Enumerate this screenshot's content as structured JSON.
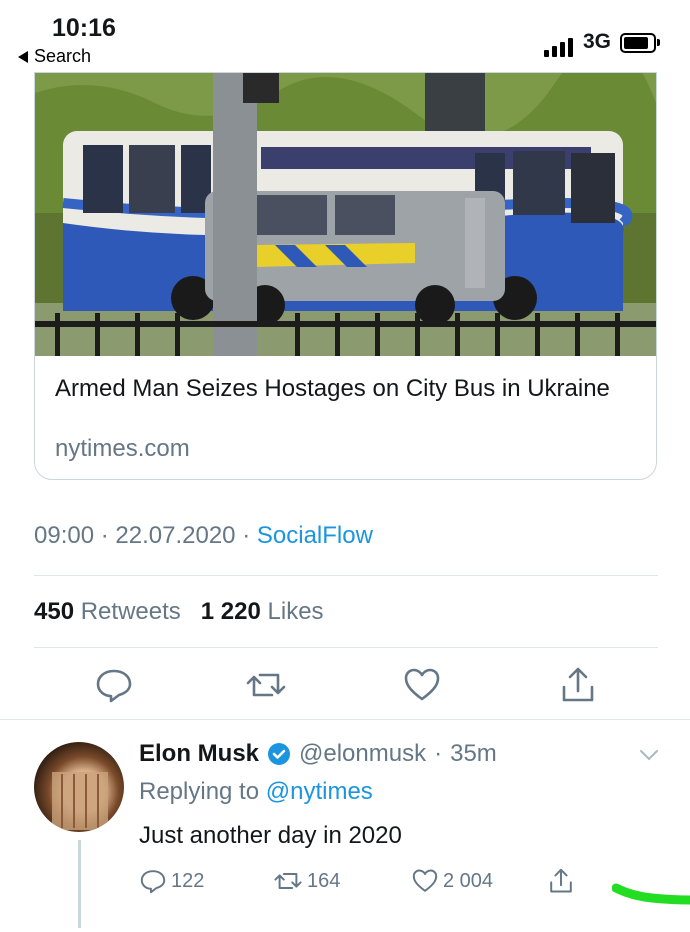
{
  "status": {
    "time": "10:16",
    "back_label": "Search",
    "network": "3G",
    "battery_level": 0.85
  },
  "card": {
    "title": "Armed Man Seizes Hostages on City Bus in Ukraine",
    "domain": "nytimes.com"
  },
  "tweet": {
    "time": "09:00",
    "date": "22.07.2020",
    "source": "SocialFlow",
    "retweets_count": "450",
    "retweets_label": "Retweets",
    "likes_count": "1 220",
    "likes_label": "Likes"
  },
  "reply": {
    "name": "Elon Musk",
    "handle": "@elonmusk",
    "age": "35m",
    "replying_prefix": "Replying to",
    "replying_to": "@nytimes",
    "text": "Just another day in 2020",
    "reply_count": "122",
    "retweet_count": "164",
    "like_count": "2 004"
  },
  "colors": {
    "accent": "#1b95e0",
    "muted": "#657786",
    "annotation": "#22dd22"
  },
  "icons": [
    "reply-icon",
    "retweet-icon",
    "like-icon",
    "share-icon",
    "verified-icon",
    "chevron-down-icon"
  ]
}
